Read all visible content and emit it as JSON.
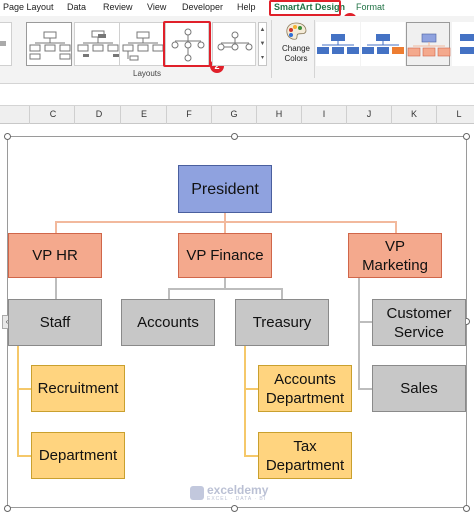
{
  "ribbon": {
    "tabs": [
      {
        "label": "Page Layout"
      },
      {
        "label": "Data"
      },
      {
        "label": "Review"
      },
      {
        "label": "View"
      },
      {
        "label": "Developer"
      },
      {
        "label": "Help"
      },
      {
        "label": "SmartArt Design"
      },
      {
        "label": "Format"
      }
    ],
    "active_tab": "SmartArt Design",
    "layouts_group_label": "Layouts",
    "change_colors_label": "Change\nColors",
    "callouts": [
      "1",
      "2"
    ],
    "accent_color": "#217346",
    "highlight_color": "#e0202a"
  },
  "columns": [
    "C",
    "D",
    "E",
    "F",
    "G",
    "H",
    "I",
    "J",
    "K",
    "L"
  ],
  "org_chart": {
    "president": "President",
    "vps": [
      "VP HR",
      "VP Finance",
      "VP\nMarketing"
    ],
    "managers": [
      "Staff",
      "Accounts",
      "Treasury",
      "Customer\nService",
      "Sales"
    ],
    "leaves": [
      "Recruitment",
      "Department",
      "Accounts\nDepartment",
      "Tax\nDepartment"
    ],
    "colors": {
      "president": "#8fa2df",
      "vp": "#f4a98d",
      "manager": "#c7c7c7",
      "leaf": "#ffd47f"
    }
  },
  "watermark": {
    "name": "exceldemy",
    "tagline": "EXCEL · DATA · BI"
  }
}
